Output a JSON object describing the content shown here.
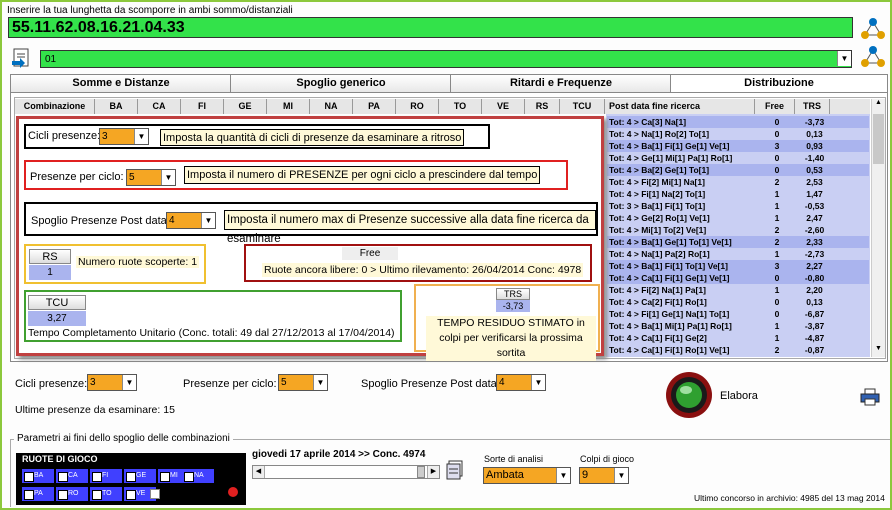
{
  "header": {
    "instruction": "Inserire la tua lunghetta da scomporre in ambi sommo/distanziali",
    "lunghetta": "55.11.62.08.16.21.04.33",
    "selection": "01"
  },
  "tabs": [
    "Somme e Distanze",
    "Spoglio generico",
    "Ritardi e Frequenze",
    "Distribuzione"
  ],
  "columns": [
    "Combinazione",
    "BA",
    "CA",
    "FI",
    "GE",
    "MI",
    "NA",
    "PA",
    "RO",
    "TO",
    "VE",
    "RS",
    "TCU"
  ],
  "right_columns": [
    "Post data fine ricerca",
    "Free",
    "TRS"
  ],
  "rows": [
    {
      "combo": "Tot: 4 > Ca[3] Na[1]",
      "free": "0",
      "trs": "-3,73",
      "hl": true
    },
    {
      "combo": "Tot: 4 > Na[1] Ro[2] To[1]",
      "free": "0",
      "trs": "0,13",
      "hl": false
    },
    {
      "combo": "Tot: 4 > Ba[1] Fi[1] Ge[1] Ve[1]",
      "free": "3",
      "trs": "0,93",
      "hl": true
    },
    {
      "combo": "Tot: 4 > Ge[1] Mi[1] Pa[1] Ro[1]",
      "free": "0",
      "trs": "-1,40",
      "hl": false
    },
    {
      "combo": "Tot: 4 > Ba[2] Ge[1] To[1]",
      "free": "0",
      "trs": "0,53",
      "hl": true
    },
    {
      "combo": "Tot: 4 > Fi[2] Mi[1] Na[1]",
      "free": "2",
      "trs": "2,53",
      "hl": false
    },
    {
      "combo": "Tot: 4 > Fi[1] Na[2] To[1]",
      "free": "1",
      "trs": "1,47",
      "hl": false
    },
    {
      "combo": "Tot: 3 > Ba[1] Fi[1] To[1]",
      "free": "1",
      "trs": "-0,53",
      "hl": false
    },
    {
      "combo": "Tot: 4 > Ge[2] Ro[1] Ve[1]",
      "free": "1",
      "trs": "2,47",
      "hl": false
    },
    {
      "combo": "Tot: 4 > Mi[1] To[2] Ve[1]",
      "free": "2",
      "trs": "-2,60",
      "hl": false
    },
    {
      "combo": "Tot: 4 > Ba[1] Ge[1] To[1] Ve[1]",
      "free": "2",
      "trs": "2,33",
      "hl": true
    },
    {
      "combo": "Tot: 4 > Na[1] Pa[2] Ro[1]",
      "free": "1",
      "trs": "-2,73",
      "hl": false
    },
    {
      "combo": "Tot: 4 > Ba[1] Fi[1] To[1] Ve[1]",
      "free": "3",
      "trs": "2,27",
      "hl": true
    },
    {
      "combo": "Tot: 4 > Ca[1] Fi[1] Ge[1] Ve[1]",
      "free": "0",
      "trs": "-0,80",
      "hl": true
    },
    {
      "combo": "Tot: 4 > Fi[2] Na[1] Pa[1]",
      "free": "1",
      "trs": "2,20",
      "hl": false
    },
    {
      "combo": "Tot: 4 > Ca[2] Fi[1] Ro[1]",
      "free": "0",
      "trs": "0,13",
      "hl": false
    },
    {
      "combo": "Tot: 4 > Fi[1] Ge[1] Na[1] To[1]",
      "free": "0",
      "trs": "-6,87",
      "hl": false
    },
    {
      "combo": "Tot: 4 > Ba[1] Mi[1] Pa[1] Ro[1]",
      "free": "1",
      "trs": "-3,87",
      "hl": false
    },
    {
      "combo": "Tot: 4 > Ca[1] Fi[1] Ge[2]",
      "free": "1",
      "trs": "-4,87",
      "hl": false
    },
    {
      "combo": "Tot: 4 > Ca[1] Fi[1] Ro[1] Ve[1]",
      "free": "2",
      "trs": "-0,87",
      "hl": false
    }
  ],
  "overlay": {
    "cicli_label": "Cicli presenze:",
    "cicli_value": "3",
    "cicli_hint": "Imposta la quantità di cicli di presenze da esaminare a ritroso",
    "presenze_label": "Presenze per ciclo:",
    "presenze_value": "5",
    "presenze_hint": "Imposta il numero di PRESENZE per ogni ciclo a prescindere dal tempo",
    "spoglio_label": "Spoglio Presenze Post data:",
    "spoglio_value": "4",
    "spoglio_hint": "Imposta il numero max di Presenze successive alla data fine ricerca da esaminare",
    "rs_label": "RS",
    "rs_value": "1",
    "rs_hint": "Numero ruote scoperte: 1",
    "free_label": "Free",
    "free_hint": "Ruote ancora libere:  0 > Ultimo rilevamento: 26/04/2014 Conc: 4978",
    "tcu_label": "TCU",
    "tcu_value": "3,27",
    "tcu_hint": "Tempo Completamento Unitario (Conc. totali: 49 dal 27/12/2013 al 17/04/2014)",
    "trs_label": "TRS",
    "trs_value": "-3,73",
    "trs_hint": "TEMPO RESIDUO STIMATO in colpi per verificarsi la prossima sortita"
  },
  "controls": {
    "cicli_label": "Cicli presenze:",
    "cicli_value": "3",
    "presenze_label": "Presenze per ciclo:",
    "presenze_value": "5",
    "spoglio_label": "Spoglio Presenze Post data:",
    "spoglio_value": "4",
    "ultime": "Ultime presenze da esaminare: 15",
    "elabora": "Elabora"
  },
  "params": {
    "legend": "Parametri ai fini dello spoglio delle combinazioni",
    "ruote_title": "RUOTE DI GIOCO",
    "ruote": [
      "BA",
      "CA",
      "FI",
      "GE",
      "MI",
      "NA",
      "PA",
      "RO",
      "TO",
      "VE"
    ],
    "date_label": "giovedi 17 aprile 2014 >> Conc. 4974",
    "sorte_label": "Sorte di analisi",
    "sorte_value": "Ambata",
    "colpi_label": "Colpi di gioco",
    "colpi_value": "9",
    "archive": "Ultimo concorso in archivio: 4985 del 13 mag 2014"
  },
  "colors": {
    "green": "#33e24a",
    "accent": "#f5a623",
    "highlight": "#aab4ee",
    "rowbg": "#c9cff3"
  }
}
